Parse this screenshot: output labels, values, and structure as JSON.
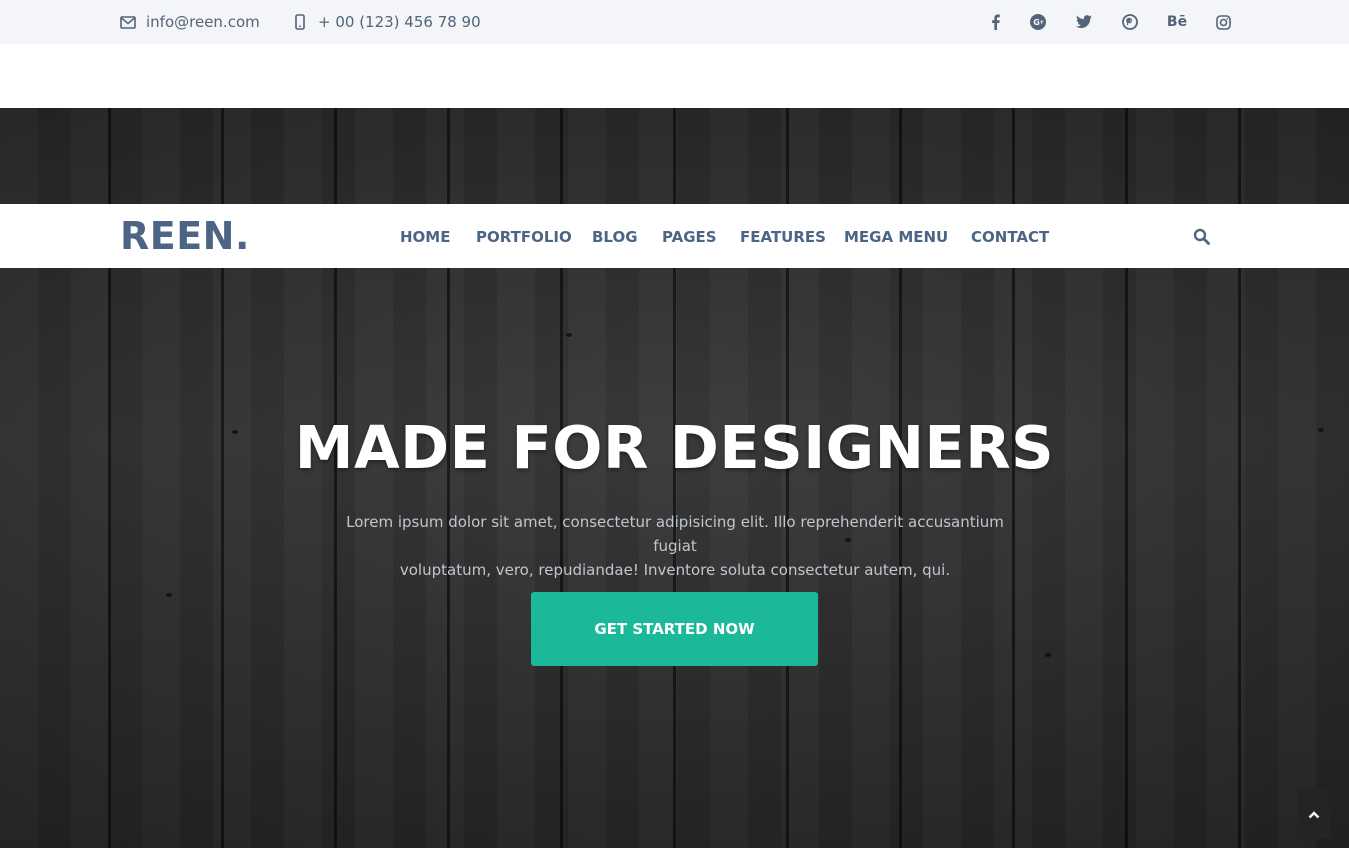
{
  "topbar": {
    "email": "info@reen.com",
    "phone": "+ 00 (123) 456 78 90",
    "social": [
      "facebook-icon",
      "google-plus-icon",
      "twitter-icon",
      "pinterest-icon",
      "behance-icon",
      "instagram-icon"
    ],
    "behance_text": "Bē"
  },
  "navbar": {
    "logo": "REEN.",
    "items": [
      "HOME",
      "PORTFOLIO",
      "BLOG",
      "PAGES",
      "FEATURES",
      "MEGA MENU",
      "CONTACT"
    ]
  },
  "hero": {
    "title": "MADE FOR DESIGNERS",
    "text_line1": "Lorem ipsum dolor sit amet, consectetur adipisicing elit. Illo reprehenderit accusantium fugiat",
    "text_line2": "voluptatum, vero, repudiandae! Inventore soluta consectetur autem, qui.",
    "cta_label": "GET STARTED NOW"
  },
  "colors": {
    "accent": "#1bb99a",
    "brand": "#4d6584",
    "topbar_bg": "#f3f5f8",
    "hero_bg": "#333333"
  }
}
